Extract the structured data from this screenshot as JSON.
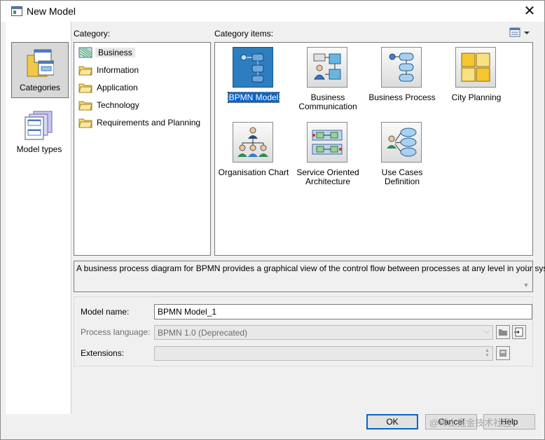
{
  "window": {
    "title": "New Model"
  },
  "nav": [
    {
      "label": "Categories",
      "icon": "categories-icon",
      "selected": true
    },
    {
      "label": "Model types",
      "icon": "model-types-icon",
      "selected": false
    }
  ],
  "category": {
    "label": "Category:",
    "items": [
      {
        "label": "Business",
        "selected": true
      },
      {
        "label": "Information"
      },
      {
        "label": "Application"
      },
      {
        "label": "Technology"
      },
      {
        "label": "Requirements and Planning"
      }
    ]
  },
  "category_items": {
    "label": "Category items:",
    "items": [
      {
        "name": "BPMN Model",
        "icon": "bpmn-model-icon",
        "selected": true
      },
      {
        "name": "Business Communication",
        "icon": "business-communication-icon"
      },
      {
        "name": "Business Process",
        "icon": "business-process-icon"
      },
      {
        "name": "City Planning",
        "icon": "city-planning-icon"
      },
      {
        "name": "Organisation Chart",
        "icon": "organisation-chart-icon"
      },
      {
        "name": "Service Oriented Architecture",
        "icon": "service-oriented-architecture-icon"
      },
      {
        "name": "Use Cases Definition",
        "icon": "use-cases-definition-icon"
      }
    ]
  },
  "description": "A business process diagram for BPMN provides a graphical view of the control flow between processes at any level in your system.",
  "form": {
    "model_name_label": "Model name:",
    "model_name_value": "BPMN Model_1",
    "process_language_label": "Process language:",
    "process_language_value": "BPMN 1.0 (Deprecated)",
    "extensions_label": "Extensions:",
    "extensions_value": ""
  },
  "buttons": {
    "ok": "OK",
    "cancel": "Cancel",
    "help": "Help"
  },
  "watermark": "@稀土掘金技术社区",
  "colors": {
    "selection": "#0a64c8",
    "dialog_bg": "#f0f0f0"
  }
}
